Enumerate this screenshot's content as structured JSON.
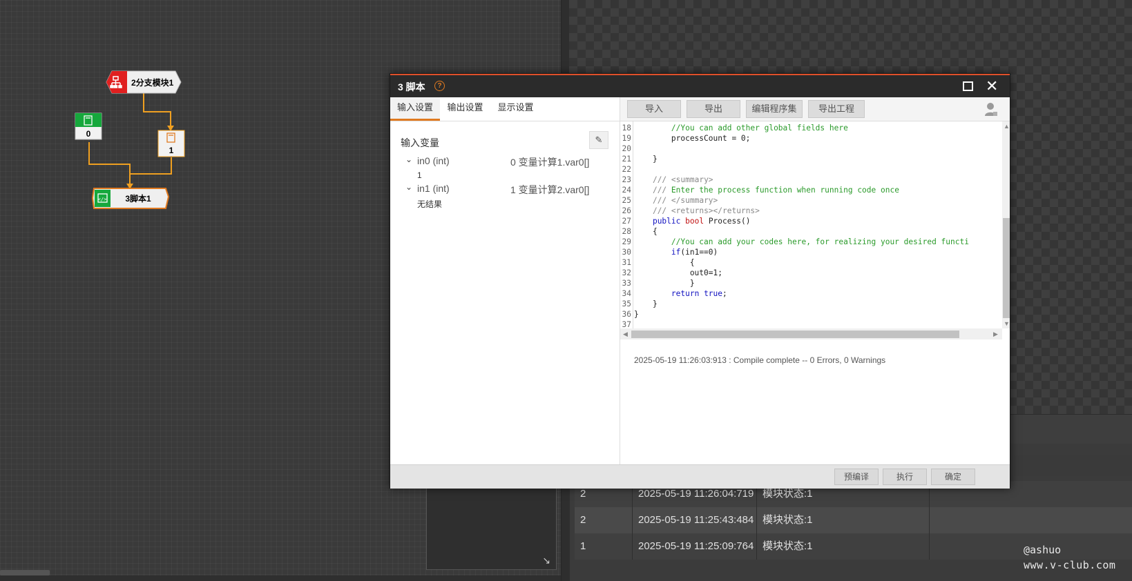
{
  "flow": {
    "node_branch": "2分支模块1",
    "node_calc0": "0",
    "node_calc1": "1",
    "node_script": "3脚本1"
  },
  "dialog": {
    "title": "3 脚本",
    "help_icon": "?",
    "close_icon": "✕",
    "tabs": [
      "输入设置",
      "输出设置",
      "显示设置"
    ],
    "section_title": "输入变量",
    "edit_icon": "✎",
    "variables": [
      {
        "name": "in0 (int)",
        "source": "0 变量计算1.var0[]",
        "value": "1"
      },
      {
        "name": "in1 (int)",
        "source": "1 变量计算2.var0[]",
        "value": "无结果"
      }
    ],
    "toolbar": [
      "导入",
      "导出",
      "编辑程序集",
      "导出工程"
    ],
    "code_lines": [
      {
        "n": "18",
        "t": "        //You can add other global fields here"
      },
      {
        "n": "19",
        "t": "        processCount = 0;"
      },
      {
        "n": "20",
        "t": ""
      },
      {
        "n": "21",
        "t": "    }"
      },
      {
        "n": "22",
        "t": ""
      },
      {
        "n": "23",
        "t": "    /// <summary>"
      },
      {
        "n": "24",
        "t": "    /// Enter the process function when running code once"
      },
      {
        "n": "25",
        "t": "    /// </summary>"
      },
      {
        "n": "26",
        "t": "    /// <returns></returns>"
      },
      {
        "n": "27",
        "t": "    public bool Process()"
      },
      {
        "n": "28",
        "t": "    {"
      },
      {
        "n": "29",
        "t": "        //You can add your codes here, for realizing your desired functi"
      },
      {
        "n": "30",
        "t": "        if(in1==0)"
      },
      {
        "n": "31",
        "t": "            {"
      },
      {
        "n": "32",
        "t": "            out0=1;"
      },
      {
        "n": "33",
        "t": "            }"
      },
      {
        "n": "34",
        "t": "        return true;"
      },
      {
        "n": "35",
        "t": "    }"
      },
      {
        "n": "36",
        "t": "}"
      },
      {
        "n": "37",
        "t": ""
      }
    ],
    "status": "2025-05-19 11:26:03:913 : Compile complete -- 0 Errors, 0 Warnings",
    "footer_buttons": [
      "预编译",
      "执行",
      "确定"
    ]
  },
  "results": [
    {
      "id": "2",
      "time": "2025-05-19 11:26:04:719",
      "status": "模块状态:1"
    },
    {
      "id": "2",
      "time": "2025-05-19 11:25:43:484",
      "status": "模块状态:1"
    },
    {
      "id": "1",
      "time": "2025-05-19 11:25:09:764",
      "status": "模块状态:1"
    }
  ],
  "watermark": {
    "line1": "@ashuo",
    "line2": "www.v-club.com"
  },
  "colors": {
    "accent": "#e07a20",
    "title_bar": "#2b2b2b",
    "title_border": "#e0502a",
    "comment": "#2a9a2a",
    "keyword": "#1010c0"
  }
}
